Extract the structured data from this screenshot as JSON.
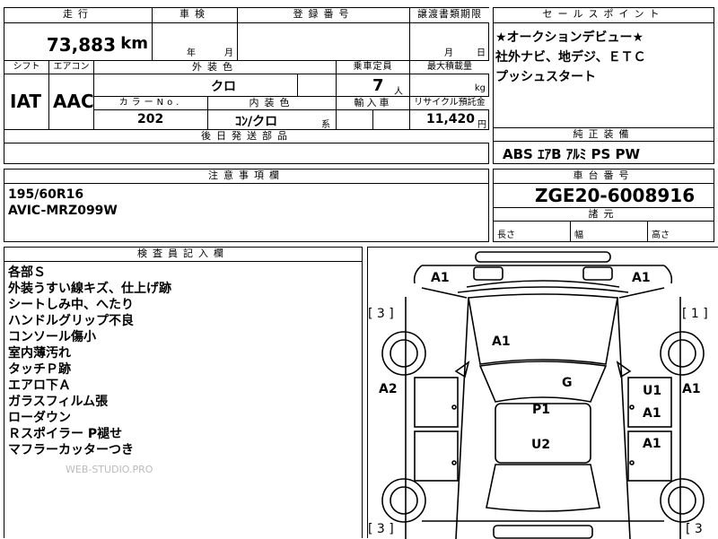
{
  "sheet": {
    "mileage_hdr": "走行",
    "inspection_hdr": "車検",
    "reg_hdr": "登録番号",
    "transfer_hdr": "譲渡書類期限",
    "mileage": "73,883",
    "mileage_unit": "km",
    "year_label": "年",
    "month_label": "月",
    "transfer_month": "月",
    "transfer_day": "日",
    "shift_hdr": "シフト",
    "ac_hdr": "エアコン",
    "exterior_hdr": "外装色",
    "seats_hdr": "乗車定員",
    "maxload_hdr": "最大積載量",
    "shift": "IAT",
    "ac": "AAC",
    "exterior_color": "クロ",
    "seats": "7",
    "seats_unit": "人",
    "load_unit": "kg",
    "color_no_hdr": "カラーNo.",
    "interior_hdr": "内装色",
    "import_hdr": "輸入車",
    "recycle_hdr": "リサイクル預託金",
    "color_no": "202",
    "interior_color": "ｺﾝ/クロ",
    "interior_suffix": "系",
    "recycle": "11,420",
    "recycle_unit": "円",
    "later_parts_hdr": "後日発送部品"
  },
  "sales": {
    "hdr": "セールスポイント",
    "line1": "★オークションデビュー★",
    "line2": "社外ナビ、地デジ、ＥＴＣ",
    "line3": "プッシュスタート"
  },
  "equipment": {
    "hdr": "純正装備",
    "items": "ABS ｴｱB ｱﾙﾐ PS PW"
  },
  "caution": {
    "hdr": "注意事項欄",
    "line1": "195/60R16",
    "line2": "AVIC-MRZ099W"
  },
  "chassis": {
    "hdr": "車台番号",
    "number": "ZGE20-6008916",
    "dims_hdr": "諸元",
    "length": "長さ",
    "width": "幅",
    "height": "高さ"
  },
  "inspector": {
    "hdr": "検査員記入欄",
    "notes": [
      "各部Ｓ",
      "外装うすい線キズ、仕上げ跡",
      "シートしみ中、へたり",
      "ハンドルグリップ不良",
      "コンソール傷小",
      "室内薄汚れ",
      "タッチＰ跡",
      "エアロ下Ａ",
      "ガラスフィルム張",
      "ローダウン",
      "Ｒスポイラー P褪せ",
      "マフラーカッターつき"
    ],
    "watermark": "WEB-STUDIO.PRO"
  },
  "diagram": {
    "front_left": "A1",
    "front_right": "A1",
    "bracket_left_top": "[ 3 ]",
    "bracket_right_top": "[ 1 ]",
    "hood": "A1",
    "windshield": "G",
    "roof": "P1",
    "rear_roof": "U2",
    "left_door": "A2",
    "right_edge": "A1",
    "right_u1": "U1",
    "right_a1a": "A1",
    "right_a1b": "A1",
    "bracket_left_bottom": "[ 3 ]",
    "bracket_right_bottom": "[ 3"
  }
}
